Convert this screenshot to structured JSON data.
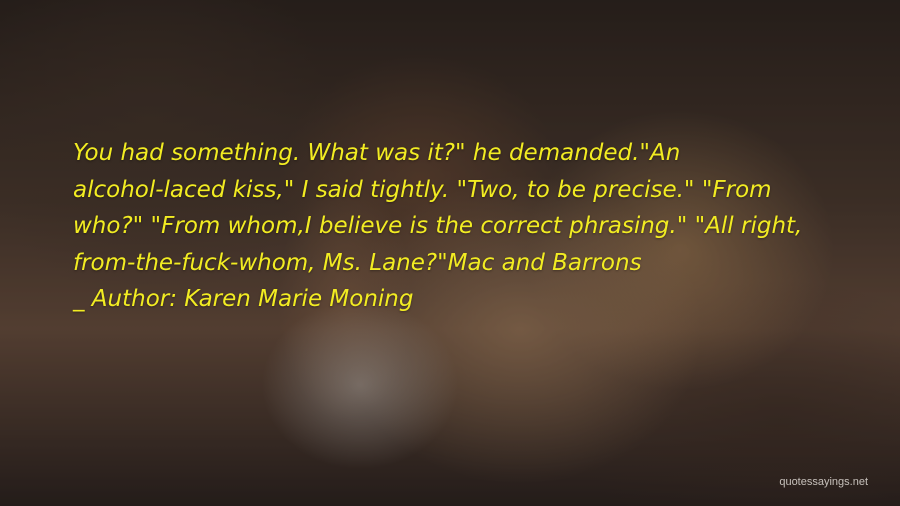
{
  "quote": {
    "lines": [
      "You had something. What was it?\" he demanded.\"An",
      "alcohol-laced kiss,\" I said tightly. \"Two, to be precise.\" \"From",
      "who?\" \"From whom,I believe is the correct phrasing.\" \"All right,",
      "from-the-fuck-whom, Ms. Lane?\"Mac and Barrons"
    ],
    "attribution": "_ Author: Karen Marie Moning",
    "color": "#f2ec22"
  },
  "watermark": "quotessayings.net"
}
